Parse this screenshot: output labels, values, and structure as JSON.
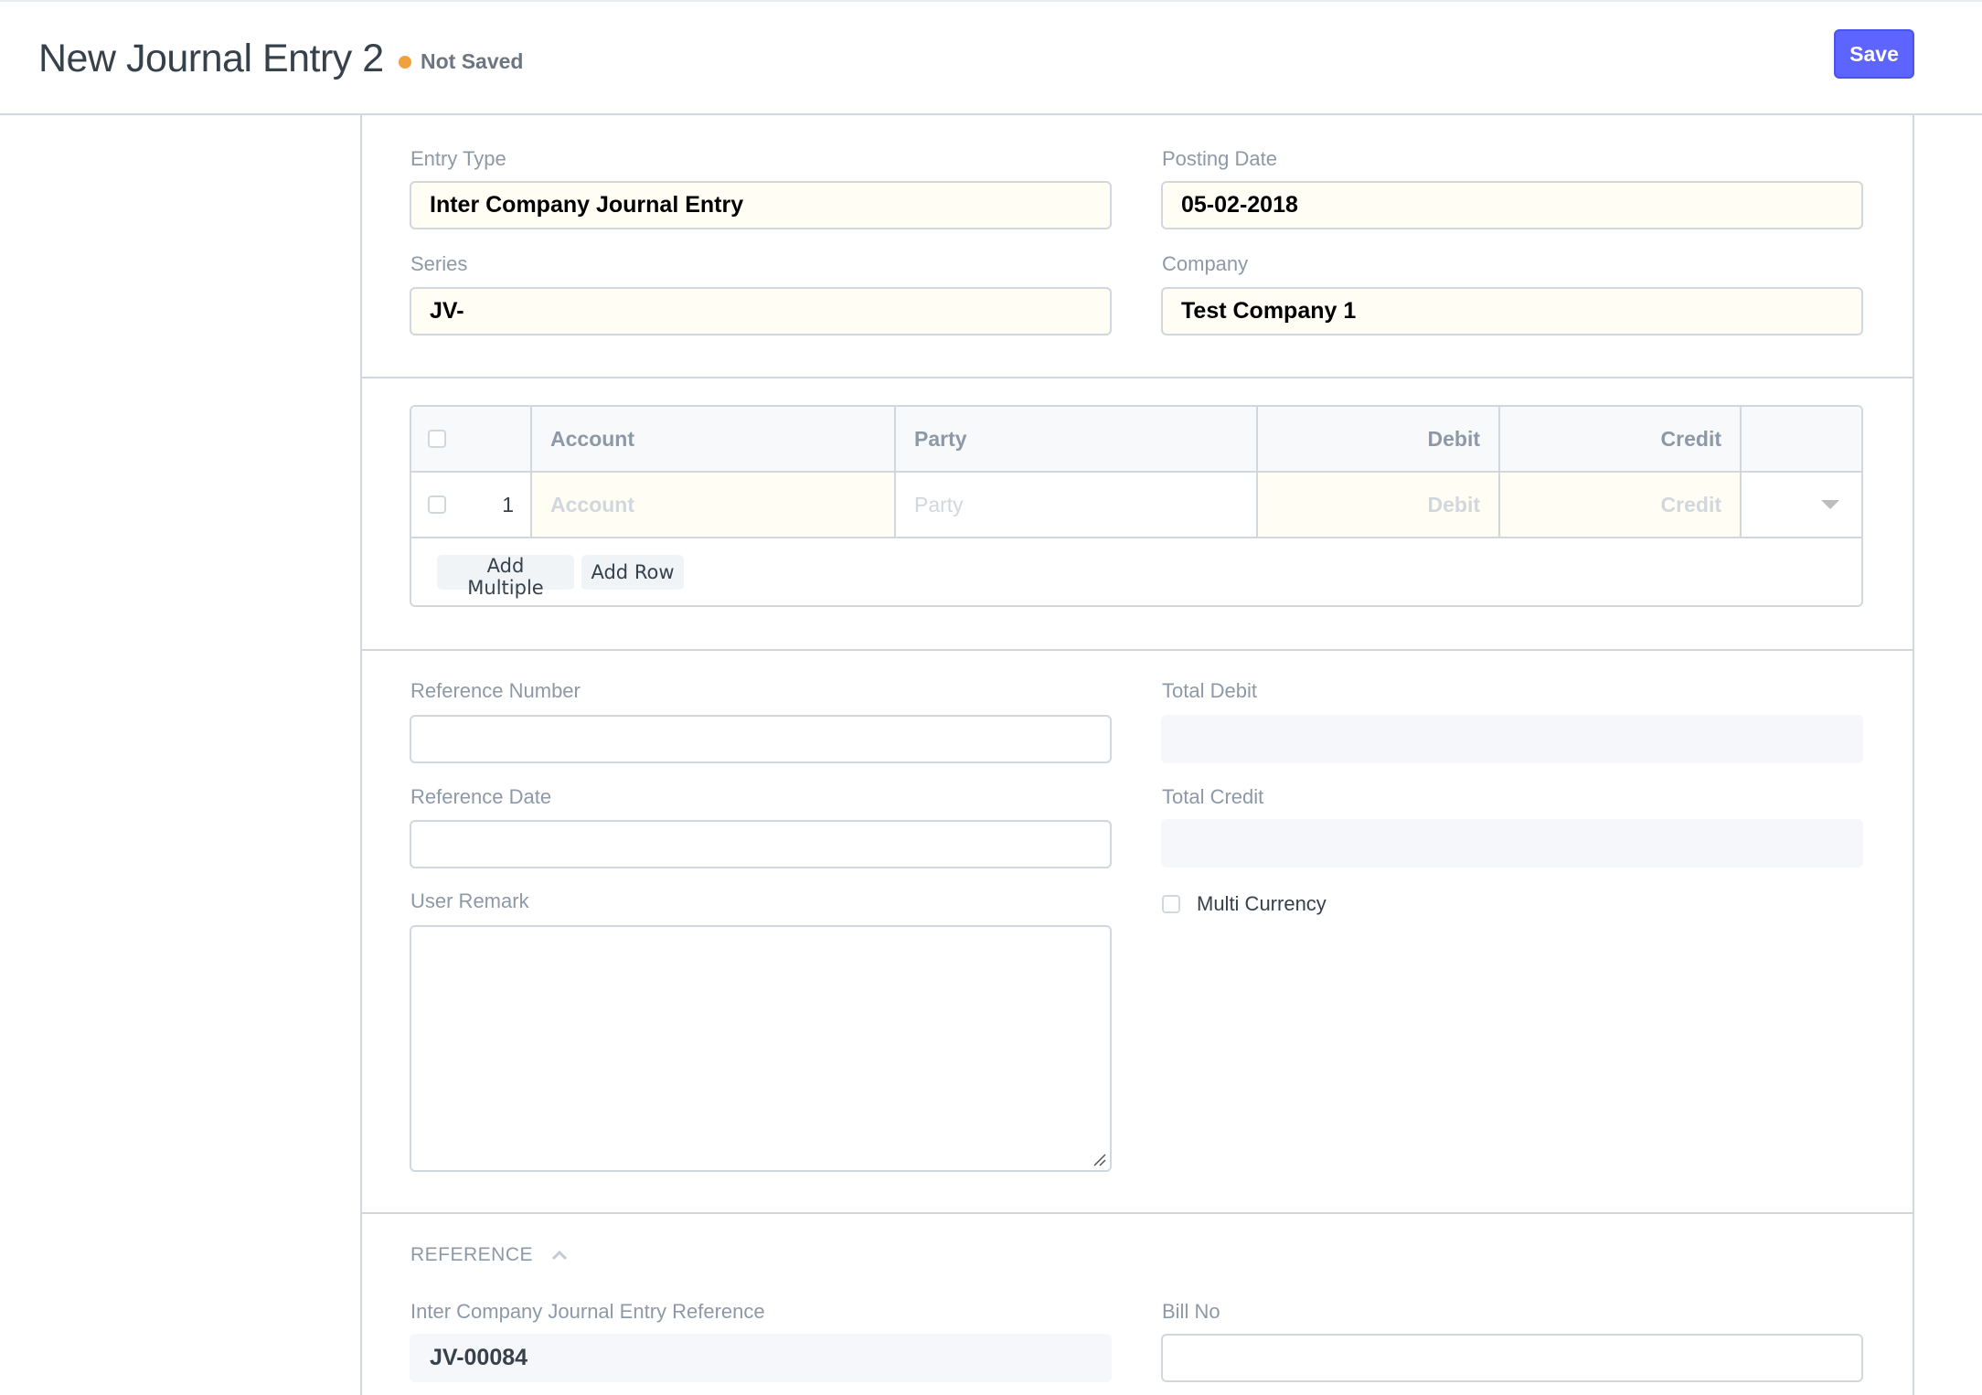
{
  "header": {
    "title": "New Journal Entry 2",
    "status": "Not Saved",
    "status_color": "#f0a03c",
    "save_label": "Save",
    "accent_color": "#5e64ff"
  },
  "details": {
    "entry_type": {
      "label": "Entry Type",
      "value": "Inter Company Journal Entry"
    },
    "posting_date": {
      "label": "Posting Date",
      "value": "05-02-2018"
    },
    "series": {
      "label": "Series",
      "value": "JV-"
    },
    "company": {
      "label": "Company",
      "value": "Test Company 1"
    }
  },
  "accounts_table": {
    "columns": [
      {
        "label": ""
      },
      {
        "label": "Account"
      },
      {
        "label": "Party"
      },
      {
        "label": "Debit"
      },
      {
        "label": "Credit"
      },
      {
        "label": ""
      }
    ],
    "rows": [
      {
        "idx": "1",
        "account_placeholder": "Account",
        "party_placeholder": "Party",
        "debit_placeholder": "Debit",
        "credit_placeholder": "Credit"
      }
    ],
    "add_multiple_label": "Add Multiple",
    "add_row_label": "Add Row"
  },
  "reference_fields": {
    "reference_number": {
      "label": "Reference Number",
      "value": ""
    },
    "reference_date": {
      "label": "Reference Date",
      "value": ""
    },
    "user_remark": {
      "label": "User Remark",
      "value": ""
    },
    "total_debit": {
      "label": "Total Debit",
      "value": ""
    },
    "total_credit": {
      "label": "Total Credit",
      "value": ""
    },
    "multi_currency": {
      "label": "Multi Currency",
      "checked": false
    }
  },
  "reference_section": {
    "title": "REFERENCE",
    "inter_company_ref": {
      "label": "Inter Company Journal Entry Reference",
      "value": "JV-00084"
    },
    "bill_no": {
      "label": "Bill No",
      "value": ""
    }
  }
}
